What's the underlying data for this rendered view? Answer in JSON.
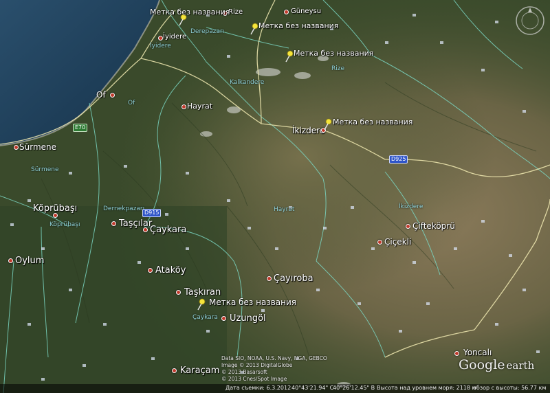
{
  "places": [
    {
      "name": "Rize",
      "kind": "place"
    },
    {
      "name": "Güneysu",
      "kind": "place"
    },
    {
      "name": "İyidere",
      "kind": "place"
    },
    {
      "name": "Of",
      "kind": "place"
    },
    {
      "name": "Hayrat",
      "kind": "place"
    },
    {
      "name": "İkizdere",
      "kind": "place"
    },
    {
      "name": "Sürmene",
      "kind": "place"
    },
    {
      "name": "Köprübaşı",
      "kind": "place"
    },
    {
      "name": "Taşçılar",
      "kind": "place"
    },
    {
      "name": "Çaykara",
      "kind": "place"
    },
    {
      "name": "Oylum",
      "kind": "place"
    },
    {
      "name": "Ataköy",
      "kind": "place"
    },
    {
      "name": "Çayıroba",
      "kind": "place"
    },
    {
      "name": "Taşkıran",
      "kind": "place"
    },
    {
      "name": "Uzungöl",
      "kind": "place"
    },
    {
      "name": "Karaçam",
      "kind": "place"
    },
    {
      "name": "Çiçekli",
      "kind": "place"
    },
    {
      "name": "Çifteköprü",
      "kind": "place"
    },
    {
      "name": "Yoncalı",
      "kind": "place"
    }
  ],
  "districts": [
    "Derepazarı",
    "İyidere",
    "Kalkandere",
    "Rize",
    "Of",
    "Sürmene",
    "Dernekpazarı",
    "Köprübaşı",
    "Hayrat",
    "İkizdere",
    "Çaykara"
  ],
  "placemarks": [
    {
      "label": "Метка без названия"
    },
    {
      "label": "Метка без названия"
    },
    {
      "label": "Метка без названия"
    },
    {
      "label": "Метка без названия"
    },
    {
      "label": "Метка без названия"
    }
  ],
  "road_shields": [
    {
      "label": "E70",
      "color": "#2d7a33"
    },
    {
      "label": "D915",
      "color": "#2f55c8"
    },
    {
      "label": "D925",
      "color": "#2f55c8"
    }
  ],
  "credits": {
    "line1": "Data SIO, NOAA, U.S. Navy, NGA, GEBCO",
    "line2": "Image © 2013 DigitalGlobe",
    "line3": "© 2013 Basarsoft",
    "line4": "© 2013 Cnes/Spot Image"
  },
  "status": {
    "imagery_date": "Дата съемки: 6.3.2012",
    "lat": "40°43'21.94\" С",
    "lon": "40°26'12.45\" В",
    "elevation": "Высота над уровнем моря: 2118 м",
    "eye_alt": "обзор с высоты: 56.77 км"
  },
  "logo": {
    "word1": "Google",
    "word2": "earth"
  },
  "colors": {
    "sea": "#1f3f5a",
    "land": "#3c4e2c",
    "pin": "#f5e53a",
    "road": "#f1eab2",
    "border": "#7ad6c2"
  }
}
